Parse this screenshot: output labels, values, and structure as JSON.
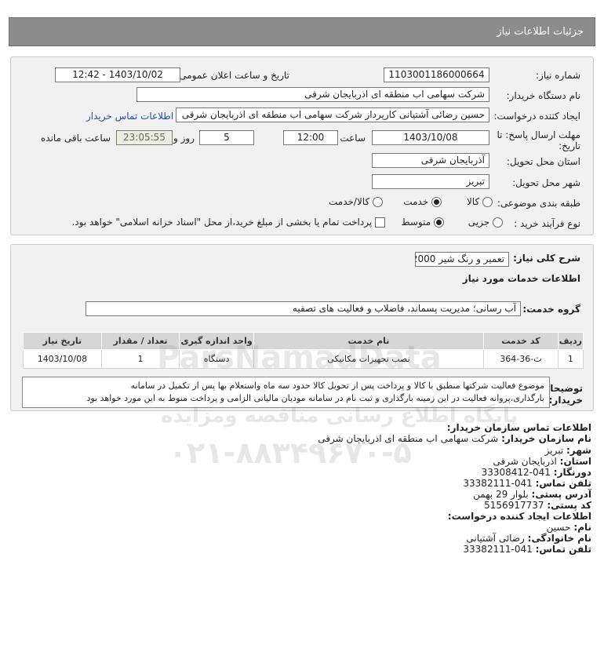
{
  "header": {
    "title": "جزئیات اطلاعات نیاز"
  },
  "form": {
    "need_number_label": "شماره نیاز:",
    "need_number": "1103001186000664",
    "announce_label": "تاریخ و ساعت اعلان عمومی:",
    "announce_value": "1403/10/02 - 12:42",
    "buyer_org_label": "نام دستگاه خریدار:",
    "buyer_org": "شرکت سهامی اب منطقه ای اذربایجان شرقی",
    "creator_label": "ایجاد کننده درخواست:",
    "creator": "حسین رضائی آشتیانی کارپرداز شرکت سهامی اب منطقه ای اذربایجان شرقی",
    "contact_link": "اطلاعات تماس خریدار",
    "deadline_label_1": "مهلت ارسال پاسخ: تا",
    "deadline_label_2": "تاریخ:",
    "deadline_date": "1403/10/08",
    "time_label": "ساعت",
    "deadline_time": "12:00",
    "days_value": "5",
    "days_label": "روز و",
    "remaining_value": "23:05:55",
    "remaining_label": "ساعت باقی مانده",
    "province_label": "استان محل تحویل:",
    "province": "آذربایجان شرقی",
    "city_label": "شهر محل تحویل:",
    "city": "تبریز",
    "category_label": "طبقه بندی موضوعی:",
    "category_options": [
      "کالا",
      "خدمت",
      "کالا/خدمت"
    ],
    "category_selected": "خدمت",
    "process_label": "نوع فرآیند خرید :",
    "process_options": [
      "جزیی",
      "متوسط"
    ],
    "process_selected": "متوسط",
    "payment_note": "پرداخت تمام یا بخشی از مبلغ خرید،از محل \"اسناد خزانه اسلامی\" خواهد بود."
  },
  "summary": {
    "label": "شرح کلی نیاز:",
    "value": "تعمیر و رنگ شیر 2000",
    "services_title": "اطلاعات خدمات مورد نیاز",
    "group_label": "گروه خدمت:",
    "group_value": "آب رسانی؛ مدیریت پسماند، فاضلاب و فعالیت های تصفیه"
  },
  "table": {
    "headers": [
      "ردیف",
      "کد خدمت",
      "نام خدمت",
      "واحد اندازه گیری",
      "تعداد / مقدار",
      "تاریخ نیاز"
    ],
    "rows": [
      [
        "1",
        "ث-36-364",
        "نصب تجهیزات مکانیکی",
        "دستگاه",
        "1",
        "1403/10/08"
      ]
    ]
  },
  "notes": {
    "label_1": "توضیحات",
    "label_2": "خریدار:",
    "line_1": "موضوع فعالیت شرکتها منطبق با کالا و پرداخت پس از تحویل کالا حدود سه ماه واستعلام بها پس از تکمیل در سامانه",
    "line_2": "بارگذاری،پروانه فعالیت در این زمینه بارگذاری و ثبت نام در سامانه مودیان مالیاتی الزامی و پرداخت منوط به این مورد خواهد بود"
  },
  "contact": {
    "title": "اطلاعات تماس سازمان خریدار:",
    "org_label": "نام سازمان خریدار:",
    "org": "شرکت سهامی اب منطقه ای اذربایجان شرقی",
    "city_label": "شهر:",
    "city": "تبریز",
    "province_label": "استان:",
    "province": "اذربایجان شرقی",
    "fax_label": "دورنگار:",
    "fax": "041-33308412",
    "phone_label": "تلفن تماس:",
    "phone": "041-33382111",
    "address_label": "آدرس پستی:",
    "address": "بلوار 29 بهمن",
    "postal_label": "کد پستی:",
    "postal": "5156917737",
    "creator_title": "اطلاعات ایجاد کننده درخواست:",
    "name_label": "نام:",
    "name": "حسین",
    "family_label": "نام خانوادگی:",
    "family": "رضائی آشتیانی",
    "creator_phone_label": "تلفن تماس:",
    "creator_phone": "041-33382111"
  },
  "watermark": {
    "brand": "ParsNamadData",
    "slogan": "پایگاه اطلاع رسانی مناقصه ومزایده",
    "phone": "۰۲۱-۸۸۳۴۹۶۷۰-۵"
  }
}
